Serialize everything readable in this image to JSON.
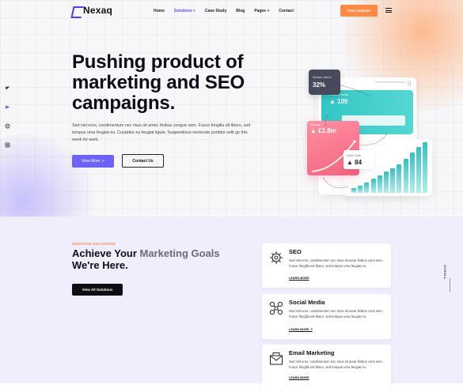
{
  "header": {
    "logo": "Nexaq",
    "nav": [
      "Home",
      "Solutions +",
      "Case Study",
      "Blog",
      "Pages +",
      "Contact"
    ],
    "cta_label": "Free Analysis",
    "menu_icon": "hamburger-icon"
  },
  "sidebar_icons": [
    "twitter-icon",
    "messenger-icon",
    "dribbble-icon",
    "instagram-icon"
  ],
  "hero": {
    "title": "Pushing product of marketing and SEO campaigns.",
    "description": "Sed nisl eros, condimentum nec risus sit amet, finibus congue sem. Fusce fringilla elt libero, sed tempus urna feugiat eu. Curabitur eu feugiat ligula. Suspendisse nectorate porttitor velit go this week for work.",
    "btn_more": "View More ↗",
    "btn_contact": "Contact Us"
  },
  "dashboard": {
    "visits_label": "Website Visitors",
    "visits_value": "32%",
    "teal_label": "Branded Views",
    "teal_value": "▲ 109",
    "pink_label": "Earnings",
    "pink_value": "▲ £1.8m",
    "stat_label": "Client Goals",
    "stat_value": "▲ 84",
    "bar_levels": [
      0.09,
      0.14,
      0.2,
      0.27,
      0.34,
      0.41,
      0.47,
      0.55,
      0.65,
      0.77,
      0.88,
      0.97
    ]
  },
  "solutions": {
    "eyebrow": "CREATIVE SOLUTIONS",
    "title_1": "Achieve Your ",
    "title_hl": "Marketing Goals",
    "title_2": " We're Here.",
    "btn_label": "View All Solutions"
  },
  "services": [
    {
      "title": "SEO",
      "text": "Sed nisl eros, condimentum nec risus sit amet finibus cons sem. Fusce fringilla est libero, sed tempus urna feugiat eu.",
      "link": "LEARN MORE",
      "icon": "gear-network-icon"
    },
    {
      "title": "Social Media",
      "text": "Sed nisl eros, condimentum nec risus sit amet finibus cons sem. Fusce fringilla est libero, sed tempus urna feugiat eu.",
      "link": "LEARN MORE ↗",
      "icon": "social-hub-icon"
    },
    {
      "title": "Email Marketing",
      "text": "Sed nisl eros, condimentum nec risus sit amet finibus cons sem. Fusce fringilla est libero, sed tempus urna feugiat eu.",
      "link": "LEARN MORE",
      "icon": "email-icon"
    }
  ],
  "scroll_label": "SCROLL"
}
